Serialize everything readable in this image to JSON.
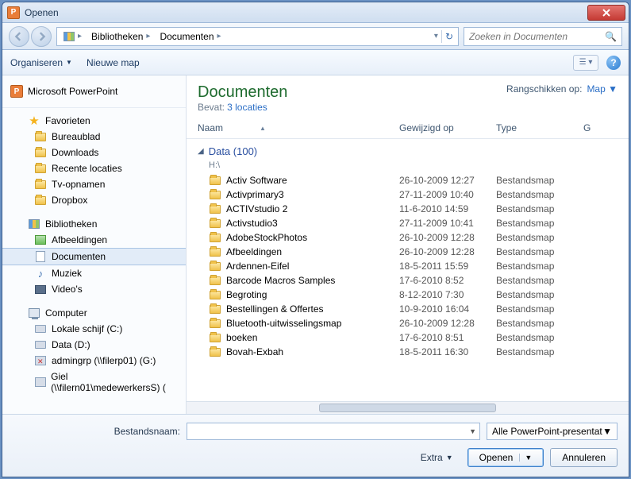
{
  "window": {
    "title": "Openen"
  },
  "nav": {
    "breadcrumb": [
      "Bibliotheken",
      "Documenten"
    ],
    "search_placeholder": "Zoeken in Documenten"
  },
  "toolbar": {
    "organize": "Organiseren",
    "new_folder": "Nieuwe map"
  },
  "sidebar": {
    "app": "Microsoft PowerPoint",
    "favorites": {
      "label": "Favorieten",
      "items": [
        "Bureaublad",
        "Downloads",
        "Recente locaties",
        "Tv-opnamen",
        "Dropbox"
      ]
    },
    "libraries": {
      "label": "Bibliotheken",
      "items": [
        "Afbeeldingen",
        "Documenten",
        "Muziek",
        "Video's"
      ],
      "selected": "Documenten"
    },
    "computer": {
      "label": "Computer",
      "items": [
        "Lokale schijf (C:)",
        "Data (D:)",
        "admingrp (\\\\filerp01) (G:)",
        "Giel (\\\\filern01\\medewerkersS) ("
      ]
    }
  },
  "main": {
    "title": "Documenten",
    "subtitle_prefix": "Bevat:",
    "subtitle_link": "3 locaties",
    "arrange_label": "Rangschikken op:",
    "arrange_value": "Map",
    "columns": {
      "name": "Naam",
      "modified": "Gewijzigd op",
      "type": "Type",
      "size": "G"
    },
    "group": {
      "name": "Data (100)",
      "source": "H:\\"
    },
    "rows": [
      {
        "name": "Activ Software",
        "date": "26-10-2009 12:27",
        "type": "Bestandsmap"
      },
      {
        "name": "Activprimary3",
        "date": "27-11-2009 10:40",
        "type": "Bestandsmap"
      },
      {
        "name": "ACTIVstudio 2",
        "date": "11-6-2010 14:59",
        "type": "Bestandsmap"
      },
      {
        "name": "Activstudio3",
        "date": "27-11-2009 10:41",
        "type": "Bestandsmap"
      },
      {
        "name": "AdobeStockPhotos",
        "date": "26-10-2009 12:28",
        "type": "Bestandsmap"
      },
      {
        "name": "Afbeeldingen",
        "date": "26-10-2009 12:28",
        "type": "Bestandsmap"
      },
      {
        "name": "Ardennen-Eifel",
        "date": "18-5-2011 15:59",
        "type": "Bestandsmap"
      },
      {
        "name": "Barcode Macros Samples",
        "date": "17-6-2010 8:52",
        "type": "Bestandsmap"
      },
      {
        "name": "Begroting",
        "date": "8-12-2010 7:30",
        "type": "Bestandsmap"
      },
      {
        "name": "Bestellingen & Offertes",
        "date": "10-9-2010 16:04",
        "type": "Bestandsmap"
      },
      {
        "name": "Bluetooth-uitwisselingsmap",
        "date": "26-10-2009 12:28",
        "type": "Bestandsmap"
      },
      {
        "name": "boeken",
        "date": "17-6-2010 8:51",
        "type": "Bestandsmap"
      },
      {
        "name": "Bovah-Exbah",
        "date": "18-5-2011 16:30",
        "type": "Bestandsmap"
      }
    ]
  },
  "footer": {
    "filename_label": "Bestandsnaam:",
    "filter": "Alle PowerPoint-presentaties (*",
    "extra": "Extra",
    "open": "Openen",
    "cancel": "Annuleren"
  }
}
